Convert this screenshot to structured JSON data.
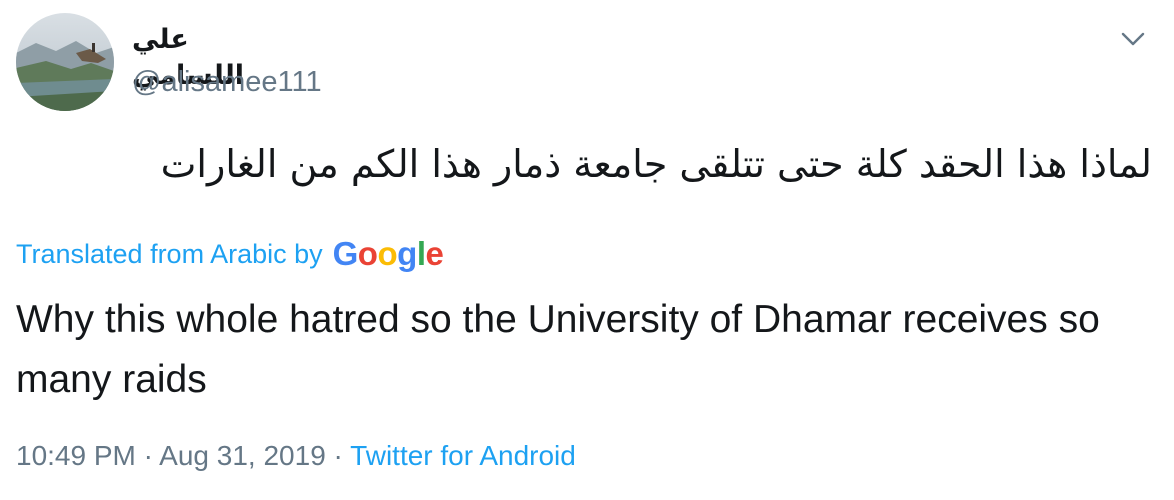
{
  "user": {
    "display_name": "علي اللسامي",
    "handle": "@alisamee111"
  },
  "tweet": {
    "text_original": "لماذا  هذا الحقد كلة حتى تتلقى جامعة ذمار هذا الكم  من  الغارات",
    "translated_label": "Translated from Arabic by",
    "translator_brand": [
      "G",
      "o",
      "o",
      "g",
      "l",
      "e"
    ],
    "text_translated": "Why this whole hatred so the University of Dhamar receives so many raids",
    "timestamp": "10:49 PM · Aug 31, 2019",
    "separator": " · ",
    "source": "Twitter for Android"
  },
  "icons": {
    "menu": "chevron-down-icon",
    "avatar": "avatar"
  },
  "colors": {
    "link": "#1da1f2",
    "text": "#14171a",
    "secondary": "#657786",
    "google_blue": "#4285F4",
    "google_red": "#EA4335",
    "google_yellow": "#FBBC05",
    "google_green": "#34A853"
  }
}
